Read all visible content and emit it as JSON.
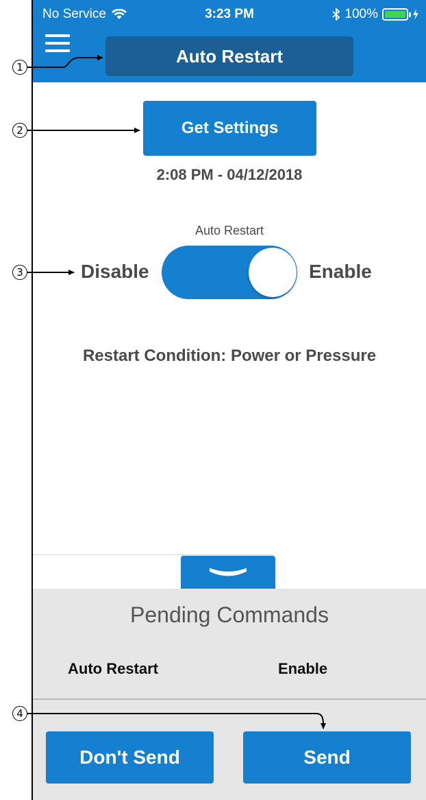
{
  "status_bar": {
    "carrier": "No Service",
    "time": "3:23 PM",
    "battery_percent": "100%",
    "battery_color": "#3fd35b"
  },
  "header": {
    "menu_icon": "hamburger-menu-icon",
    "title": "Auto Restart",
    "background_color": "#1580d0"
  },
  "main": {
    "get_settings_label": "Get Settings",
    "timestamp": "2:08 PM - 04/12/2018",
    "toggle": {
      "title": "Auto Restart",
      "off_label": "Disable",
      "on_label": "Enable",
      "state": "on"
    },
    "restart_condition": "Restart Condition: Power or Pressure"
  },
  "pending": {
    "collapse_icon": "chevron-down-icon",
    "title": "Pending Commands",
    "commands": [
      {
        "command": "Auto Restart",
        "value": "Enable"
      }
    ],
    "dont_send_label": "Don't Send",
    "send_label": "Send"
  },
  "callouts": [
    "1",
    "2",
    "3",
    "4"
  ]
}
